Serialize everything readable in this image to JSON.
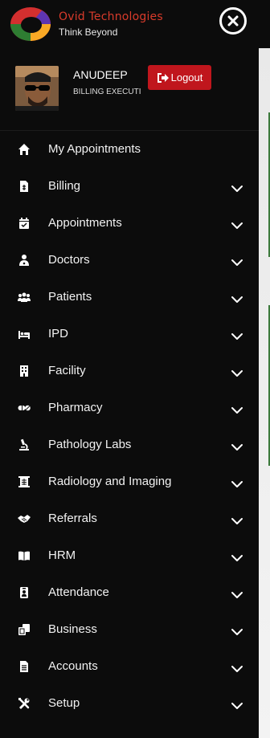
{
  "header": {
    "brand_name": "Ovid Technologies",
    "tagline": "Think Beyond",
    "logo_colors": [
      "#d32f2f",
      "#2e7d32",
      "#f9a825",
      "#5e35b1"
    ]
  },
  "profile": {
    "name": "ANUDEEP",
    "role": "BILLING EXECUTI",
    "logout_label": "Logout",
    "logout_color": "#c0161d"
  },
  "menu": {
    "items": [
      {
        "label": "My Appointments",
        "icon": "home-icon",
        "expandable": false
      },
      {
        "label": "Billing",
        "icon": "invoice-icon",
        "expandable": true
      },
      {
        "label": "Appointments",
        "icon": "calendar-check-icon",
        "expandable": true
      },
      {
        "label": "Doctors",
        "icon": "doctor-icon",
        "expandable": true
      },
      {
        "label": "Patients",
        "icon": "users-icon",
        "expandable": true
      },
      {
        "label": "IPD",
        "icon": "bed-icon",
        "expandable": true
      },
      {
        "label": "Facility",
        "icon": "hospital-building-icon",
        "expandable": true
      },
      {
        "label": "Pharmacy",
        "icon": "pills-icon",
        "expandable": true
      },
      {
        "label": "Pathology Labs",
        "icon": "microscope-icon",
        "expandable": true
      },
      {
        "label": "Radiology and Imaging",
        "icon": "xray-icon",
        "expandable": true
      },
      {
        "label": "Referrals",
        "icon": "handshake-icon",
        "expandable": true
      },
      {
        "label": "HRM",
        "icon": "book-open-icon",
        "expandable": true
      },
      {
        "label": "Attendance",
        "icon": "id-badge-icon",
        "expandable": true
      },
      {
        "label": "Business",
        "icon": "copy-icon",
        "expandable": true
      },
      {
        "label": "Accounts",
        "icon": "document-icon",
        "expandable": true
      },
      {
        "label": "Setup",
        "icon": "tools-icon",
        "expandable": true
      }
    ]
  }
}
